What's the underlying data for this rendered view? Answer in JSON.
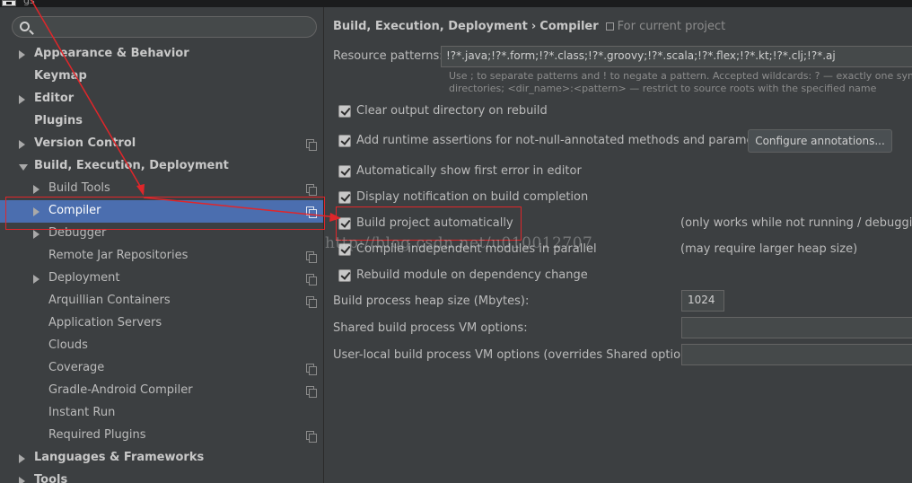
{
  "window": {
    "title": "gs"
  },
  "search": {
    "value": "",
    "placeholder": ""
  },
  "sidebar": {
    "items": [
      {
        "label": "Appearance & Behavior",
        "expander": "collapsed",
        "copy_icon": false
      },
      {
        "label": "Keymap",
        "expander": "none",
        "copy_icon": false
      },
      {
        "label": "Editor",
        "expander": "collapsed",
        "copy_icon": false
      },
      {
        "label": "Plugins",
        "expander": "none",
        "copy_icon": false
      },
      {
        "label": "Version Control",
        "expander": "collapsed",
        "copy_icon": true
      },
      {
        "label": "Build, Execution, Deployment",
        "expander": "expanded",
        "copy_icon": false
      },
      {
        "label": "Build Tools",
        "expander": "collapsed",
        "copy_icon": true
      },
      {
        "label": "Compiler",
        "expander": "collapsed",
        "copy_icon": true,
        "selected": true
      },
      {
        "label": "Debugger",
        "expander": "collapsed",
        "copy_icon": false
      },
      {
        "label": "Remote Jar Repositories",
        "expander": "none",
        "copy_icon": true
      },
      {
        "label": "Deployment",
        "expander": "collapsed",
        "copy_icon": true
      },
      {
        "label": "Arquillian Containers",
        "expander": "none",
        "copy_icon": true
      },
      {
        "label": "Application Servers",
        "expander": "none",
        "copy_icon": false
      },
      {
        "label": "Clouds",
        "expander": "none",
        "copy_icon": false
      },
      {
        "label": "Coverage",
        "expander": "none",
        "copy_icon": true
      },
      {
        "label": "Gradle-Android Compiler",
        "expander": "none",
        "copy_icon": true
      },
      {
        "label": "Instant Run",
        "expander": "none",
        "copy_icon": false
      },
      {
        "label": "Required Plugins",
        "expander": "none",
        "copy_icon": true
      },
      {
        "label": "Languages & Frameworks",
        "expander": "collapsed",
        "copy_icon": false
      },
      {
        "label": "Tools",
        "expander": "collapsed",
        "copy_icon": false
      }
    ]
  },
  "breadcrumb": {
    "parent": "Build, Execution, Deployment",
    "separator": "›",
    "current": "Compiler",
    "scope": "For current project"
  },
  "resource_patterns": {
    "label": "Resource patterns:",
    "value": "!?*.java;!?*.form;!?*.class;!?*.groovy;!?*.scala;!?*.flex;!?*.kt;!?*.clj;!?*.aj",
    "hint_line1": "Use ; to separate patterns and ! to negate a pattern. Accepted wildcards: ? — exactly one symbol; *",
    "hint_line2": "directories; <dir_name>:<pattern> — restrict to source roots with the specified name"
  },
  "options": [
    {
      "label": "Clear output directory on rebuild",
      "checked": true,
      "note": ""
    },
    {
      "label": "Add runtime assertions for not-null-annotated methods and parameters",
      "checked": true,
      "note": ""
    },
    {
      "label": "Automatically show first error in editor",
      "checked": true,
      "note": ""
    },
    {
      "label": "Display notification on build completion",
      "checked": true,
      "note": ""
    },
    {
      "label": "Build project automatically",
      "checked": true,
      "note": "(only works while not running / debugging)"
    },
    {
      "label": "Compile independent modules in parallel",
      "checked": true,
      "note": "(may require larger heap size)"
    },
    {
      "label": "Rebuild module on dependency change",
      "checked": true,
      "note": ""
    }
  ],
  "configure_button": {
    "label": "Configure annotations..."
  },
  "heap": {
    "label": "Build process heap size (Mbytes):",
    "value": "1024"
  },
  "shared_vm": {
    "label": "Shared build process VM options:",
    "value": ""
  },
  "user_vm": {
    "label": "User-local build process VM options (overrides Shared options):",
    "value": ""
  },
  "watermark": {
    "text": "http://blog.csdn.net/u010012707"
  },
  "colors": {
    "selection": "#4b6eaf",
    "annotation": "#e0262a",
    "background": "#3c3f41"
  }
}
